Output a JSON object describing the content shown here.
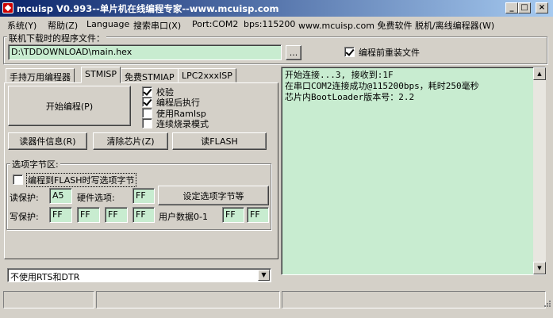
{
  "window": {
    "title": "mcuisp V0.993--单片机在线编程专家--www.mcuisp.com",
    "buttons": [
      "_",
      "□",
      "×"
    ]
  },
  "menu": [
    "系统(Y)",
    "帮助(Z)",
    "Language",
    "搜索串口(X)",
    "Port:COM2",
    "bps:115200",
    "www.mcuisp.com 免费软件 脱机/离线编程器(W)"
  ],
  "file": {
    "label": "联机下载时的程序文件：",
    "path": "D:\\TDDOWNLOAD\\main.hex",
    "browse_label": "...",
    "reload_label": "编程前重装文件",
    "reload_checked": true
  },
  "tabs": [
    {
      "label": "手持万用编程器",
      "active": false
    },
    {
      "label": "STMISP",
      "active": true
    },
    {
      "label": "免费STMIAP",
      "active": false
    },
    {
      "label": "LPC2xxxISP",
      "active": false
    }
  ],
  "actions": {
    "start_program": "开始编程(P)",
    "read_info": "读器件信息(R)",
    "clear_chip": "清除芯片(Z)",
    "read_flash": "读FLASH"
  },
  "options": {
    "verify": {
      "label": "校验",
      "checked": true
    },
    "run_after": {
      "label": "编程后执行",
      "checked": true
    },
    "use_ramisp": {
      "label": "使用RamIsp",
      "checked": false
    },
    "continuous": {
      "label": "连续烧录模式",
      "checked": false
    }
  },
  "option_bytes": {
    "group_title": "选项字节区:",
    "write_on_flash": {
      "label": "编程到FLASH时写选项字节",
      "checked": false
    },
    "read_protect_label": "读保护:",
    "read_protect_value": "A5",
    "hw_option_label": "硬件选项:",
    "hw_option_value": "FF",
    "set_button": "设定选项字节等",
    "write_protect_label": "写保护:",
    "write_protect_values": [
      "FF",
      "FF",
      "FF",
      "FF"
    ],
    "user_data_label": "用户数据0-1",
    "user_data_values": [
      "FF",
      "FF"
    ]
  },
  "rts_dtr": {
    "selected": "不使用RTS和DTR"
  },
  "log_lines": [
    "开始连接...3, 接收到:1F",
    "在串口COM2连接成功@115200bps，耗时250毫秒",
    "芯片内BootLoader版本号：2.2"
  ],
  "colors": {
    "title_gradient_start": "#0a246a",
    "title_gradient_end": "#a6caf0",
    "field_bg": "#c8ecd0",
    "face": "#d4d0c8"
  }
}
